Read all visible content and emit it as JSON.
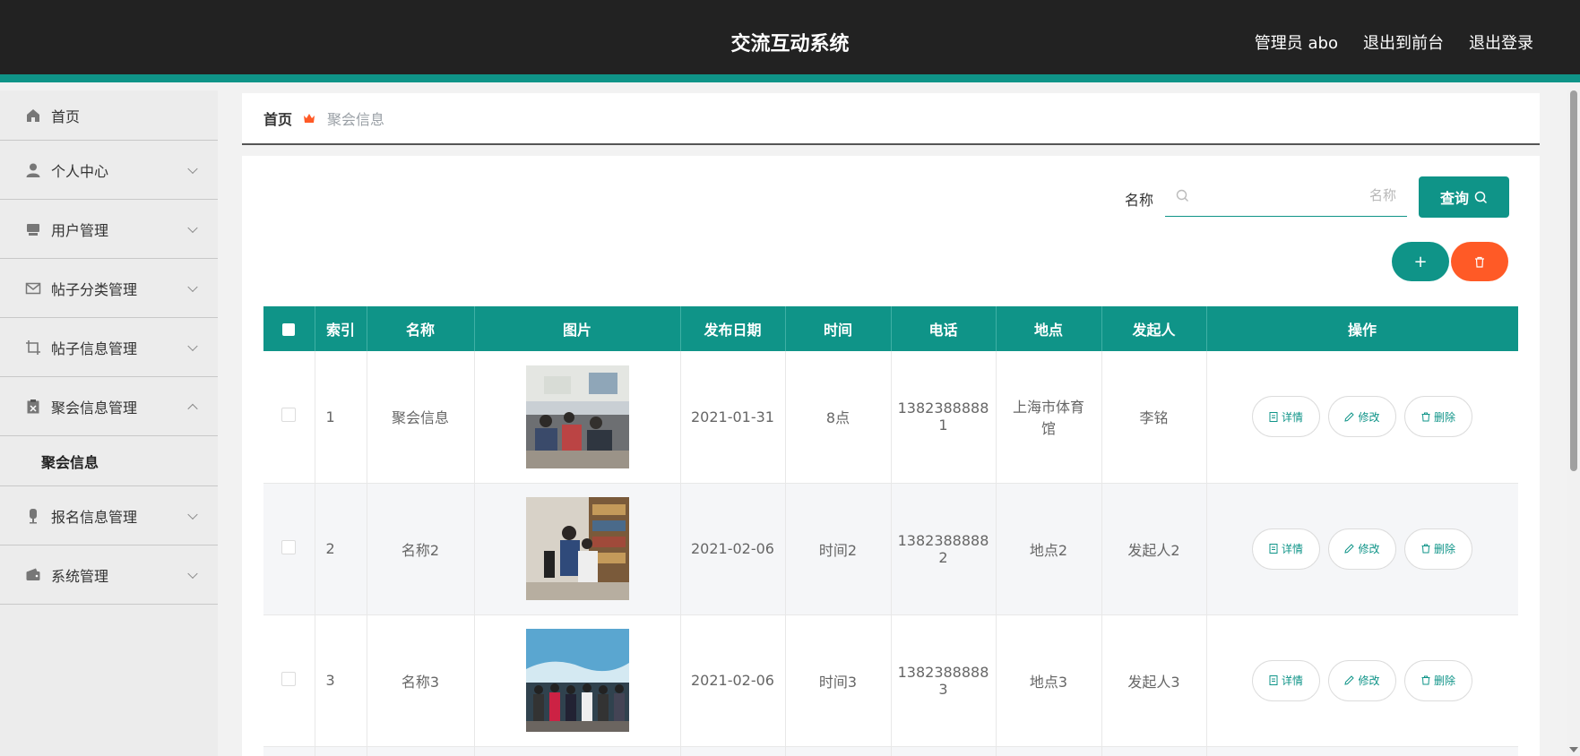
{
  "header": {
    "title": "交流互动系统",
    "links": [
      "管理员 abo",
      "退出到前台",
      "退出登录"
    ]
  },
  "sidebar": {
    "items": [
      {
        "label": "首页",
        "icon": "home-icon"
      },
      {
        "label": "个人中心",
        "icon": "user-icon"
      },
      {
        "label": "用户管理",
        "icon": "users-icon"
      },
      {
        "label": "帖子分类管理",
        "icon": "mail-icon"
      },
      {
        "label": "帖子信息管理",
        "icon": "crop-icon"
      },
      {
        "label": "聚会信息管理",
        "icon": "clipboard-icon",
        "expanded": true
      },
      {
        "label": "报名信息管理",
        "icon": "microphone-icon"
      },
      {
        "label": "系统管理",
        "icon": "wallet-icon"
      }
    ],
    "submenu": {
      "label": "聚会信息"
    }
  },
  "breadcrumb": {
    "home": "首页",
    "current": "聚会信息"
  },
  "search": {
    "label": "名称",
    "placeholder": "名称",
    "value": "",
    "button": "查询"
  },
  "actions": {
    "add": "+"
  },
  "colors": {
    "accent": "#0f9488",
    "danger": "#ff5a26",
    "header": "#222222"
  },
  "table": {
    "columns": [
      "",
      "索引",
      "名称",
      "图片",
      "发布日期",
      "时间",
      "电话",
      "地点",
      "发起人",
      "操作"
    ],
    "op_labels": {
      "detail": "详情",
      "edit": "修改",
      "delete": "删除"
    },
    "rows": [
      {
        "index": "1",
        "name": "聚会信息",
        "date": "2021-01-31",
        "time": "8点",
        "phone": [
          "1382388888",
          "1"
        ],
        "place": [
          "上海市体育",
          "馆"
        ],
        "initiator": "李铭"
      },
      {
        "index": "2",
        "name": "名称2",
        "date": "2021-02-06",
        "time": "时间2",
        "phone": [
          "1382388888",
          "2"
        ],
        "place": [
          "地点2"
        ],
        "initiator": "发起人2"
      },
      {
        "index": "3",
        "name": "名称3",
        "date": "2021-02-06",
        "time": "时间3",
        "phone": [
          "1382388888",
          "3"
        ],
        "place": [
          "地点3"
        ],
        "initiator": "发起人3"
      }
    ]
  }
}
